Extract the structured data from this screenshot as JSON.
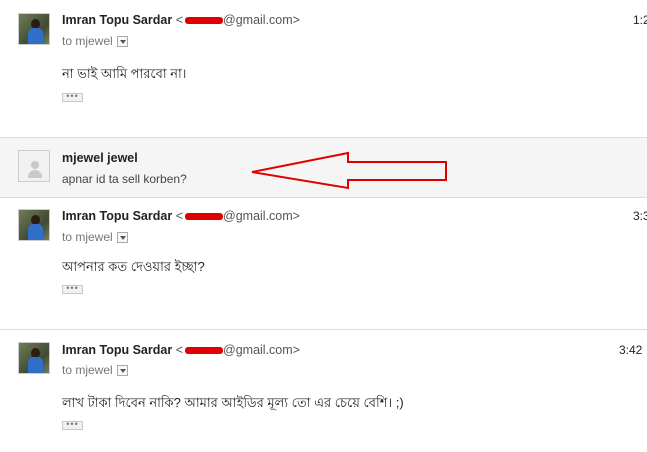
{
  "messages": [
    {
      "sender": "Imran Topu Sardar",
      "email_prefix": "<",
      "email_suffix": "@gmail.com>",
      "to": "to mjewel",
      "time": "1:2",
      "body": "না ভাই আমি পারবো না।",
      "more": "•••"
    },
    {
      "sender": "mjewel jewel",
      "snippet": "apnar id ta sell korben?"
    },
    {
      "sender": "Imran Topu Sardar",
      "email_prefix": "<",
      "email_suffix": "@gmail.com>",
      "to": "to mjewel",
      "time": "3:3",
      "body": "আপনার কত দেওয়ার ইচ্ছা?",
      "more": "•••"
    },
    {
      "sender": "Imran Topu Sardar",
      "email_prefix": "<",
      "email_suffix": "@gmail.com>",
      "to": "to mjewel",
      "time": "3:42",
      "body": "লাখ টাকা দিবেন নাকি? আমার আইডির মূল্য তো এর চেয়ে বেশি। ;)",
      "more": "•••"
    }
  ],
  "colors": {
    "annotation_arrow": "#e00000",
    "redaction": "#e00000",
    "collapsed_bg": "#f5f5f5"
  }
}
